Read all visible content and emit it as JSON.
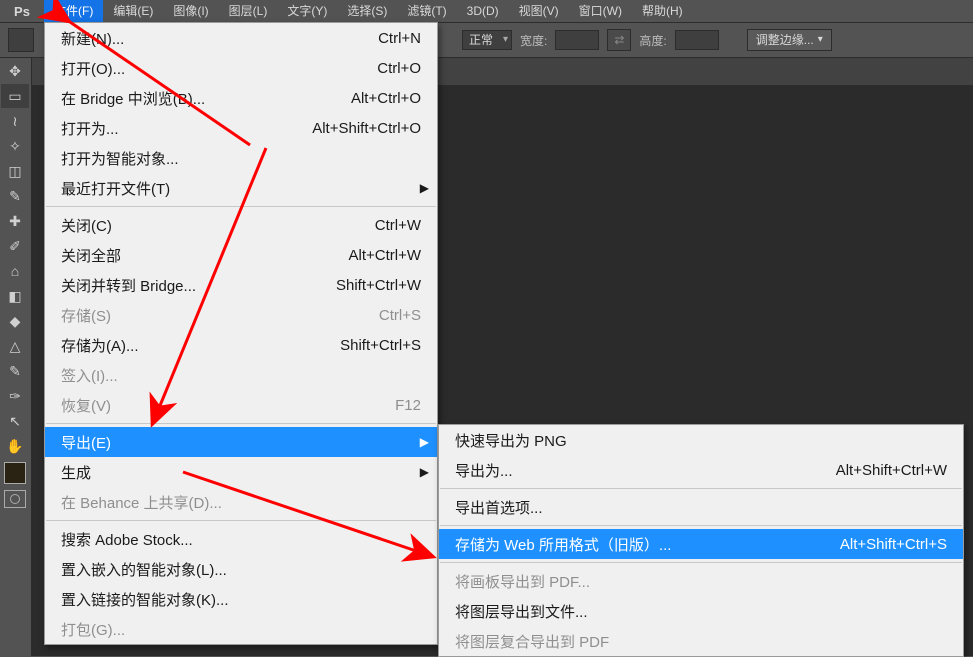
{
  "menubar": {
    "logo": "Ps",
    "items": [
      {
        "label": "文件(F)",
        "open": true
      },
      {
        "label": "编辑(E)"
      },
      {
        "label": "图像(I)"
      },
      {
        "label": "图层(L)"
      },
      {
        "label": "文字(Y)"
      },
      {
        "label": "选择(S)"
      },
      {
        "label": "滤镜(T)"
      },
      {
        "label": "3D(D)"
      },
      {
        "label": "视图(V)"
      },
      {
        "label": "窗口(W)"
      },
      {
        "label": "帮助(H)"
      }
    ]
  },
  "optbar": {
    "combo": "正常",
    "width_label": "宽度:",
    "height_label": "高度:",
    "refine": "调整边缘..."
  },
  "file_menu": [
    {
      "t": "item",
      "label": "新建(N)...",
      "sc": "Ctrl+N"
    },
    {
      "t": "item",
      "label": "打开(O)...",
      "sc": "Ctrl+O"
    },
    {
      "t": "item",
      "label": "在 Bridge 中浏览(B)...",
      "sc": "Alt+Ctrl+O"
    },
    {
      "t": "item",
      "label": "打开为...",
      "sc": "Alt+Shift+Ctrl+O"
    },
    {
      "t": "item",
      "label": "打开为智能对象..."
    },
    {
      "t": "item",
      "label": "最近打开文件(T)",
      "sub": true
    },
    {
      "t": "sep"
    },
    {
      "t": "item",
      "label": "关闭(C)",
      "sc": "Ctrl+W"
    },
    {
      "t": "item",
      "label": "关闭全部",
      "sc": "Alt+Ctrl+W"
    },
    {
      "t": "item",
      "label": "关闭并转到 Bridge...",
      "sc": "Shift+Ctrl+W"
    },
    {
      "t": "item",
      "label": "存储(S)",
      "sc": "Ctrl+S",
      "dis": true
    },
    {
      "t": "item",
      "label": "存储为(A)...",
      "sc": "Shift+Ctrl+S"
    },
    {
      "t": "item",
      "label": "签入(I)...",
      "dis": true
    },
    {
      "t": "item",
      "label": "恢复(V)",
      "sc": "F12",
      "dis": true
    },
    {
      "t": "sep"
    },
    {
      "t": "item",
      "label": "导出(E)",
      "sub": true,
      "hi": true
    },
    {
      "t": "item",
      "label": "生成",
      "sub": true
    },
    {
      "t": "item",
      "label": "在 Behance 上共享(D)...",
      "dis": true
    },
    {
      "t": "sep"
    },
    {
      "t": "item",
      "label": "搜索 Adobe Stock..."
    },
    {
      "t": "item",
      "label": "置入嵌入的智能对象(L)..."
    },
    {
      "t": "item",
      "label": "置入链接的智能对象(K)..."
    },
    {
      "t": "item",
      "label": "打包(G)...",
      "dis": true
    }
  ],
  "export_menu": [
    {
      "t": "item",
      "label": "快速导出为 PNG"
    },
    {
      "t": "item",
      "label": "导出为...",
      "sc": "Alt+Shift+Ctrl+W"
    },
    {
      "t": "sep"
    },
    {
      "t": "item",
      "label": "导出首选项..."
    },
    {
      "t": "sep"
    },
    {
      "t": "item",
      "label": "存储为 Web 所用格式（旧版）...",
      "sc": "Alt+Shift+Ctrl+S",
      "hi": true
    },
    {
      "t": "sep"
    },
    {
      "t": "item",
      "label": "将画板导出到 PDF...",
      "dis": true
    },
    {
      "t": "item",
      "label": "将图层导出到文件..."
    },
    {
      "t": "item",
      "label": "将图层复合导出到 PDF",
      "dis": true
    }
  ],
  "tools": [
    "move",
    "marquee",
    "lasso",
    "wand",
    "crop",
    "eyedrop",
    "heal",
    "brush",
    "stamp",
    "eraser",
    "bucket",
    "blur",
    "clone",
    "pen",
    "pointer",
    "hand"
  ]
}
